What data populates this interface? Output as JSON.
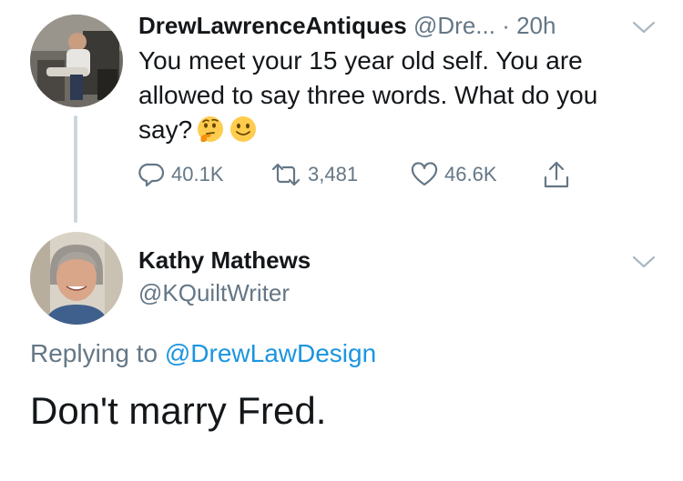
{
  "tweet": {
    "author_name": "DrewLawrenceAntiques",
    "author_handle": "@Dre...",
    "separator": "·",
    "time": "20h",
    "text_line1": "You meet your 15 year old self. You are",
    "text_line2": "allowed to say three words. What do you",
    "text_line3": "say?",
    "emojis": [
      "thinking-face",
      "slightly-smiling-face"
    ],
    "actions": {
      "replies": "40.1K",
      "retweets": "3,481",
      "likes": "46.6K"
    }
  },
  "reply": {
    "author_name": "Kathy Mathews",
    "author_handle": "@KQuiltWriter",
    "replying_prefix": "Replying to",
    "replying_to": "@DrewLawDesign",
    "text": "Don't marry Fred."
  },
  "colors": {
    "text": "#14171a",
    "secondary": "#657786",
    "link": "#1b95e0",
    "thread_line": "#ccd6dd"
  }
}
